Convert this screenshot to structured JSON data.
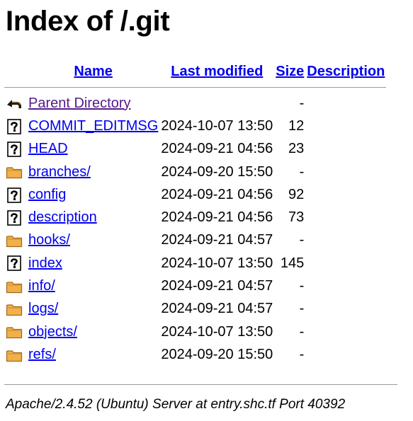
{
  "page": {
    "title": "Index of /.git"
  },
  "columns": {
    "name": "Name",
    "last_modified": "Last modified",
    "size": "Size",
    "description": "Description"
  },
  "rows": [
    {
      "icon": "back-icon",
      "name": "Parent Directory",
      "modified": "",
      "size": "-",
      "visited": true
    },
    {
      "icon": "unknown-file-icon",
      "name": "COMMIT_EDITMSG",
      "modified": "2024-10-07 13:50",
      "size": "12"
    },
    {
      "icon": "unknown-file-icon",
      "name": "HEAD",
      "modified": "2024-09-21 04:56",
      "size": "23"
    },
    {
      "icon": "folder-icon",
      "name": "branches/",
      "modified": "2024-09-20 15:50",
      "size": "-"
    },
    {
      "icon": "unknown-file-icon",
      "name": "config",
      "modified": "2024-09-21 04:56",
      "size": "92"
    },
    {
      "icon": "unknown-file-icon",
      "name": "description",
      "modified": "2024-09-21 04:56",
      "size": "73"
    },
    {
      "icon": "folder-icon",
      "name": "hooks/",
      "modified": "2024-09-21 04:57",
      "size": "-"
    },
    {
      "icon": "unknown-file-icon",
      "name": "index",
      "modified": "2024-10-07 13:50",
      "size": "145"
    },
    {
      "icon": "folder-icon",
      "name": "info/",
      "modified": "2024-09-21 04:57",
      "size": "-"
    },
    {
      "icon": "folder-icon",
      "name": "logs/",
      "modified": "2024-09-21 04:57",
      "size": "-"
    },
    {
      "icon": "folder-icon",
      "name": "objects/",
      "modified": "2024-10-07 13:50",
      "size": "-"
    },
    {
      "icon": "folder-icon",
      "name": "refs/",
      "modified": "2024-09-20 15:50",
      "size": "-"
    }
  ],
  "footer": {
    "server_signature": "Apache/2.4.52 (Ubuntu) Server at entry.shc.tf Port 40392"
  },
  "colors": {
    "link": "#0000ee",
    "visited_link": "#551a8b",
    "rule": "#9a9a9a",
    "folder": "#e8a33d"
  }
}
